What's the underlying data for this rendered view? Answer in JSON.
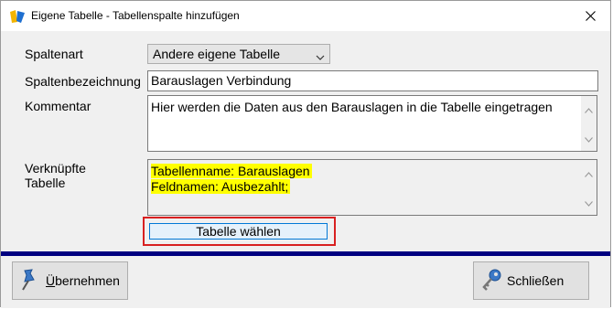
{
  "window": {
    "title": "Eigene Tabelle - Tabellenspalte hinzufügen"
  },
  "fields": {
    "spaltenart": {
      "label": "Spaltenart",
      "value": "Andere eigene Tabelle"
    },
    "spaltenbezeichnung": {
      "label": "Spaltenbezeichnung",
      "value": "Barauslagen Verbindung"
    },
    "kommentar": {
      "label": "Kommentar",
      "value": "Hier werden die Daten aus den Barauslagen in die Tabelle eingetragen"
    },
    "verknuepfte": {
      "label_line1": "Verknüpfte",
      "label_line2": "Tabelle",
      "line1": "Tabellenname: Barauslagen",
      "line2": "Feldnamen: Ausbezahlt;"
    }
  },
  "buttons": {
    "tabelle_waehlen": "Tabelle wählen",
    "uebernehmen_first": "Ü",
    "uebernehmen_rest": "bernehmen",
    "schliessen": "Schließen"
  },
  "colors": {
    "highlight": "#ffff00",
    "accent_bar": "#000080",
    "focus_frame": "#d82020"
  }
}
